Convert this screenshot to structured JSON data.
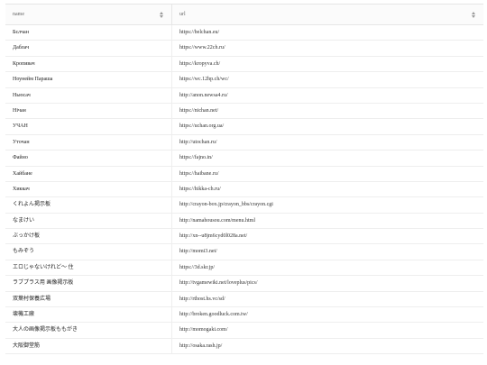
{
  "table": {
    "columns": [
      {
        "label": "name"
      },
      {
        "label": "url"
      }
    ],
    "rows": [
      {
        "name": "Бєлчан",
        "url": "https://belchan.eu/"
      },
      {
        "name": "Даблач",
        "url": "https://www.22ch.ru/"
      },
      {
        "name": "Кропивач",
        "url": "https://kropyva.ch/"
      },
      {
        "name": "Ноунейм Параша",
        "url": "https://wc.12hp.ch/wc/"
      },
      {
        "name": "Ньюсач",
        "url": "http://anon.newsa4.ru/"
      },
      {
        "name": "Нічан",
        "url": "https://nichan.net/"
      },
      {
        "name": "УЧАН",
        "url": "https://uchan.org.ua/"
      },
      {
        "name": "Уточан",
        "url": "http://utochan.ru/"
      },
      {
        "name": "Файно",
        "url": "https://fajno.in/"
      },
      {
        "name": "Хайбане",
        "url": "https://haibane.ru/"
      },
      {
        "name": "Хиккач",
        "url": "https://hikka-ch.ru/"
      },
      {
        "name": "くれよん掲示板",
        "url": "http://crayon-box.jp/crayon_bbs/crayon.cgi"
      },
      {
        "name": "なまけい",
        "url": "http://namahousou.com/menu.html"
      },
      {
        "name": "ぶっかけ板",
        "url": "http://xn--u8jm6cyd0l028a.net/"
      },
      {
        "name": "もみぞう",
        "url": "http://momi3.net/"
      },
      {
        "name": "エロじゃないけれど〜 住",
        "url": "https://3d.skr.jp/"
      },
      {
        "name": "ラブプラス用 画像掲示板",
        "url": "http://tvgamewiki.net/loveplus/pics/"
      },
      {
        "name": "双葉村保養広場",
        "url": "http://rthost.hs.vc/sd/"
      },
      {
        "name": "壊機工廠",
        "url": "http://broken.goodluck.com.tw/"
      },
      {
        "name": "大人の画像掲示板ももがき",
        "url": "http://momogaki.com/"
      },
      {
        "name": "大阪御堂筋",
        "url": "http://osaka.rash.jp/"
      }
    ]
  }
}
